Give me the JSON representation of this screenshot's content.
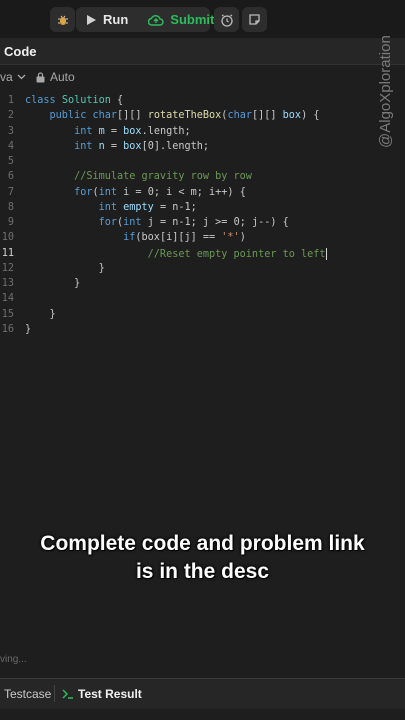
{
  "toolbar": {
    "run_label": "Run",
    "submit_label": "Submit"
  },
  "panel": {
    "title": "Code",
    "language": "va",
    "autosave": "Auto"
  },
  "editor": {
    "line_numbers": [
      "1",
      "2",
      "3",
      "4",
      "5",
      "6",
      "7",
      "8",
      "9",
      "10",
      "11",
      "12",
      "13",
      "14",
      "15",
      "16"
    ],
    "current_line": "11",
    "lines": [
      [
        {
          "t": "class ",
          "c": "kw"
        },
        {
          "t": "Solution ",
          "c": "ty"
        },
        {
          "t": "{",
          "c": "br"
        }
      ],
      [
        {
          "t": "    public ",
          "c": "kw"
        },
        {
          "t": "char",
          "c": "kw"
        },
        {
          "t": "[][] ",
          "c": "br"
        },
        {
          "t": "rotateTheBox",
          "c": "fn"
        },
        {
          "t": "(",
          "c": "br"
        },
        {
          "t": "char",
          "c": "kw"
        },
        {
          "t": "[][] ",
          "c": "br"
        },
        {
          "t": "box",
          "c": "var"
        },
        {
          "t": ") {",
          "c": "br"
        }
      ],
      [
        {
          "t": "        int ",
          "c": "kw"
        },
        {
          "t": "m",
          "c": "var"
        },
        {
          "t": " = ",
          "c": "br"
        },
        {
          "t": "box",
          "c": "var"
        },
        {
          "t": ".length;",
          "c": "br"
        }
      ],
      [
        {
          "t": "        int ",
          "c": "kw"
        },
        {
          "t": "n",
          "c": "var"
        },
        {
          "t": " = ",
          "c": "br"
        },
        {
          "t": "box",
          "c": "var"
        },
        {
          "t": "[0].length;",
          "c": "br"
        }
      ],
      [],
      [
        {
          "t": "        //Simulate gravity row by row",
          "c": "cm"
        }
      ],
      [
        {
          "t": "        for",
          "c": "kw"
        },
        {
          "t": "(",
          "c": "br"
        },
        {
          "t": "int ",
          "c": "kw"
        },
        {
          "t": "i = 0; i < m; i++) {",
          "c": "br"
        }
      ],
      [
        {
          "t": "            int ",
          "c": "kw"
        },
        {
          "t": "empty",
          "c": "var"
        },
        {
          "t": " = n-1;",
          "c": "br"
        }
      ],
      [
        {
          "t": "            for",
          "c": "kw"
        },
        {
          "t": "(",
          "c": "br"
        },
        {
          "t": "int ",
          "c": "kw"
        },
        {
          "t": "j = n-1; j >= 0; j--) {",
          "c": "br"
        }
      ],
      [
        {
          "t": "                if",
          "c": "kw"
        },
        {
          "t": "(box[i][j] == ",
          "c": "br"
        },
        {
          "t": "'*'",
          "c": "str"
        },
        {
          "t": ")",
          "c": "br"
        }
      ],
      [
        {
          "t": "                    //Reset empty pointer to left",
          "c": "cm"
        }
      ],
      [
        {
          "t": "            }",
          "c": "br"
        }
      ],
      [
        {
          "t": "        }",
          "c": "br"
        }
      ],
      [],
      [
        {
          "t": "    }",
          "c": "br"
        }
      ],
      [
        {
          "t": "}",
          "c": "br"
        }
      ]
    ]
  },
  "caption": {
    "line1": "Complete code and problem link",
    "line2": "is in the desc"
  },
  "status": {
    "saving": "ving..."
  },
  "bottom_tabs": {
    "testcase": "Testcase",
    "test_result": "Test Result"
  },
  "watermark": "@AlgoXploration",
  "colors": {
    "run_text": "#e6e6e6",
    "submit_green": "#2cbb5d",
    "background": "#1e1e1e"
  }
}
